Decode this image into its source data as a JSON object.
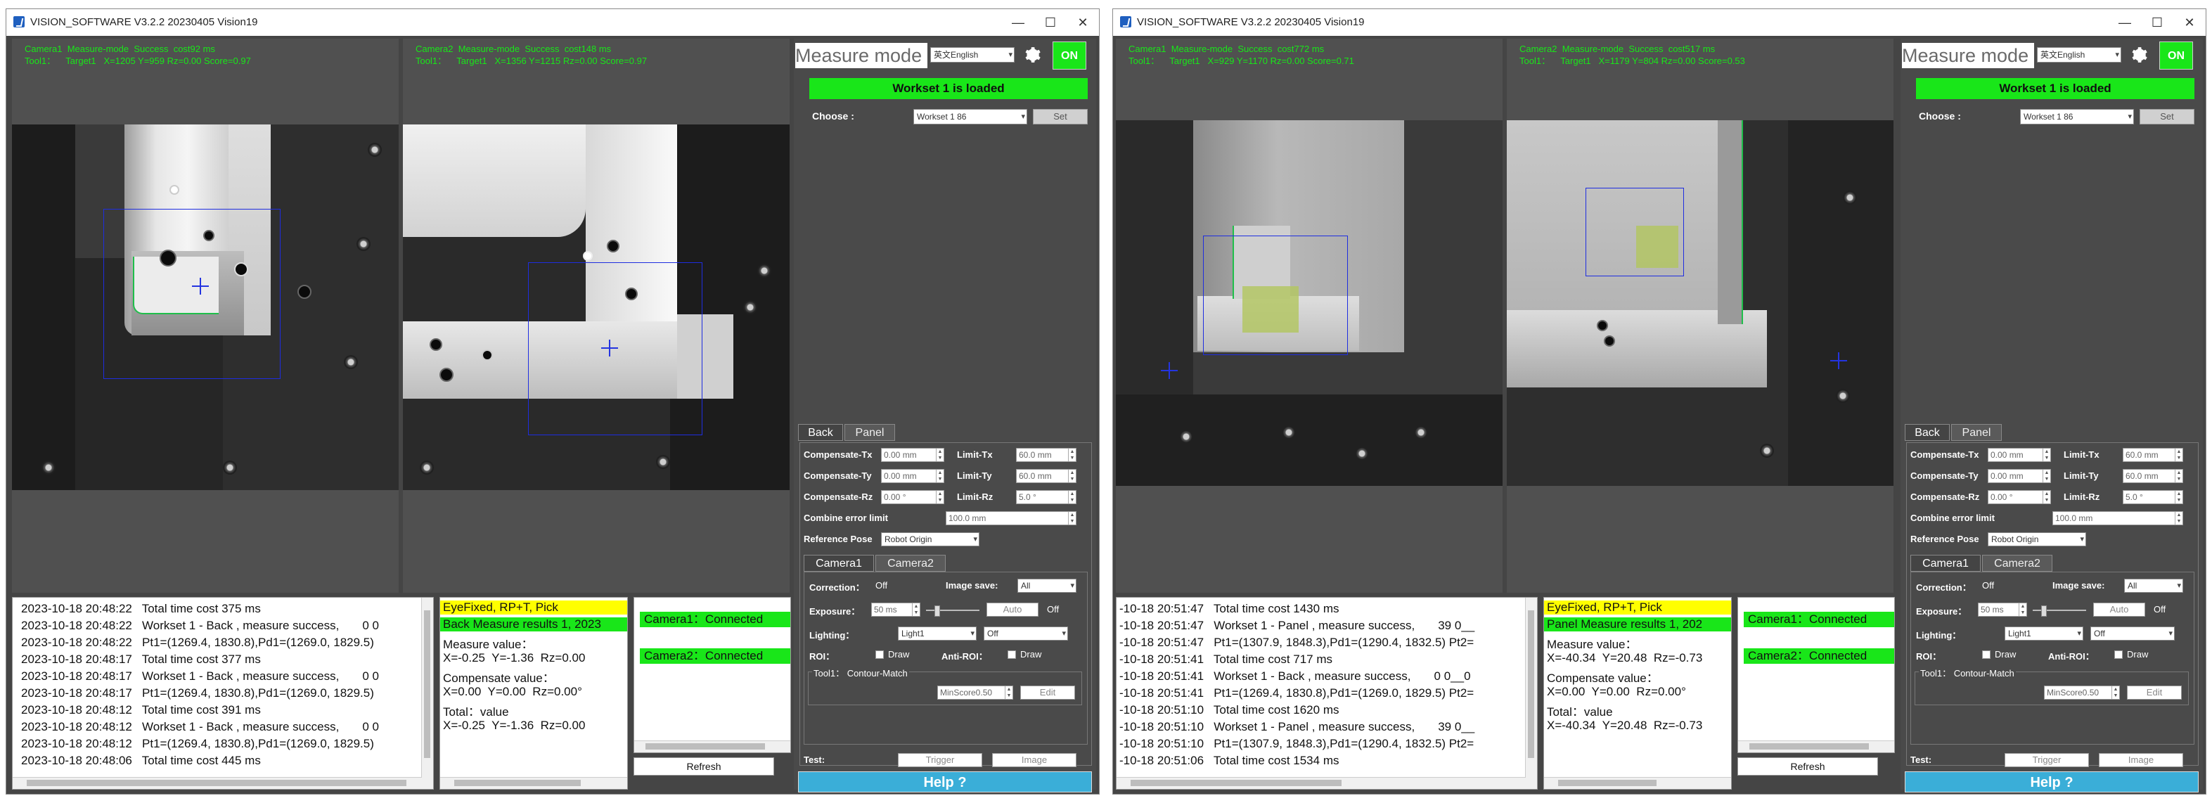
{
  "windows": [
    {
      "title": "VISION_SOFTWARE V3.2.2 20230405  Vision19",
      "cameras": [
        {
          "line1": "Camera1  Measure-mode  Success  cost92 ms",
          "line2": "Tool1：    Target1   X=1205 Y=959 Rz=0.00 Score=0.97"
        },
        {
          "line1": "Camera2  Measure-mode  Success  cost148 ms",
          "line2": "Tool1：    Target1   X=1356 Y=1215 Rz=0.00 Score=0.97"
        }
      ],
      "panel": {
        "title": "Measure mode",
        "language": "英文English",
        "on_label": "ON",
        "banner": "Workset 1 is loaded",
        "choose_label": "Choose :",
        "workset": "Workset 1 86",
        "set_label": "Set",
        "tab_back": "Back",
        "tab_panel": "Panel",
        "comp_tx_label": "Compensate-Tx",
        "comp_tx": "0.00 mm",
        "limit_tx_label": "Limit-Tx",
        "limit_tx": "60.0 mm",
        "comp_ty_label": "Compensate-Ty",
        "comp_ty": "0.00 mm",
        "limit_ty_label": "Limit-Ty",
        "limit_ty": "60.0 mm",
        "comp_rz_label": "Compensate-Rz",
        "comp_rz": "0.00 °",
        "limit_rz_label": "Limit-Rz",
        "limit_rz": "5.0 °",
        "combine_label": "Combine error limit",
        "combine": "100.0 mm",
        "refpose_label": "Reference Pose",
        "refpose": "Robot Origin",
        "tab_cam1": "Camera1",
        "tab_cam2": "Camera2",
        "correction_label": "Correction：",
        "correction": "Off",
        "imgsave_label": "Image save:",
        "imgsave": "All",
        "exposure_label": "Exposure：",
        "exposure": "50 ms",
        "auto_label": "Auto",
        "exposure_state": "Off",
        "lighting_label": "Lighting：",
        "lighting": "Light1",
        "lighting_state": "Off",
        "roi_label": "ROI：",
        "draw_label": "Draw",
        "anti_roi_label": "Anti-ROI：",
        "draw2_label": "Draw",
        "tool_label": "Tool1：  Contour-Match",
        "minscore": "MinScore0.50",
        "edit_label": "Edit",
        "test_label": "Test:",
        "trigger_label": "Trigger",
        "image_label": "Image",
        "help_label": "Help ?"
      },
      "log": [
        "2023-10-18 20:48:22   Total time cost 375 ms",
        "2023-10-18 20:48:22   Workset 1 - Back , measure success,       0 0",
        "2023-10-18 20:48:22   Pt1=(1269.4, 1830.8),Pd1=(1269.0, 1829.5)",
        "2023-10-18 20:48:17   Total time cost 377 ms",
        "2023-10-18 20:48:17   Workset 1 - Back , measure success,       0 0",
        "2023-10-18 20:48:17   Pt1=(1269.4, 1830.8),Pd1=(1269.0, 1829.5)",
        "2023-10-18 20:48:12   Total time cost 391 ms",
        "2023-10-18 20:48:12   Workset 1 - Back , measure success,       0 0",
        "2023-10-18 20:48:12   Pt1=(1269.4, 1830.8),Pd1=(1269.0, 1829.5)",
        "2023-10-18 20:48:06   Total time cost 445 ms"
      ],
      "results": [
        "EyeFixed, RP+T, Pick",
        "Back Measure results 1, 2023",
        "Measure value：",
        "X=-0.25  Y=-1.36  Rz=0.00",
        "Compensate value：",
        "X=0.00  Y=0.00  Rz=0.00°",
        "Total：value",
        "X=-0.25  Y=-1.36  Rz=0.00"
      ],
      "connections": [
        "Camera1：Connected",
        "Camera2：Connected"
      ],
      "refresh_label": "Refresh"
    },
    {
      "title": "VISION_SOFTWARE V3.2.2 20230405  Vision19",
      "cameras": [
        {
          "line1": "Camera1  Measure-mode  Success  cost772 ms",
          "line2": "Tool1：    Target1   X=929 Y=1170 Rz=0.00 Score=0.71"
        },
        {
          "line1": "Camera2  Measure-mode  Success  cost517 ms",
          "line2": "Tool1：    Target1   X=1179 Y=804 Rz=0.00 Score=0.53"
        }
      ],
      "panel": {
        "title": "Measure mode",
        "language": "英文English",
        "on_label": "ON",
        "banner": "Workset 1 is loaded",
        "choose_label": "Choose :",
        "workset": "Workset 1 86",
        "set_label": "Set",
        "tab_back": "Back",
        "tab_panel": "Panel",
        "comp_tx_label": "Compensate-Tx",
        "comp_tx": "0.00 mm",
        "limit_tx_label": "Limit-Tx",
        "limit_tx": "60.0 mm",
        "comp_ty_label": "Compensate-Ty",
        "comp_ty": "0.00 mm",
        "limit_ty_label": "Limit-Ty",
        "limit_ty": "60.0 mm",
        "comp_rz_label": "Compensate-Rz",
        "comp_rz": "0.00 °",
        "limit_rz_label": "Limit-Rz",
        "limit_rz": "5.0 °",
        "combine_label": "Combine error limit",
        "combine": "100.0 mm",
        "refpose_label": "Reference Pose",
        "refpose": "Robot Origin",
        "tab_cam1": "Camera1",
        "tab_cam2": "Camera2",
        "correction_label": "Correction：",
        "correction": "Off",
        "imgsave_label": "Image save:",
        "imgsave": "All",
        "exposure_label": "Exposure：",
        "exposure": "50 ms",
        "auto_label": "Auto",
        "exposure_state": "Off",
        "lighting_label": "Lighting：",
        "lighting": "Light1",
        "lighting_state": "Off",
        "roi_label": "ROI：",
        "draw_label": "Draw",
        "anti_roi_label": "Anti-ROI：",
        "draw2_label": "Draw",
        "tool_label": "Tool1：  Contour-Match",
        "minscore": "MinScore0.50",
        "edit_label": "Edit",
        "test_label": "Test:",
        "trigger_label": "Trigger",
        "image_label": "Image",
        "help_label": "Help ?"
      },
      "log": [
        "-10-18 20:51:47   Total time cost 1430 ms",
        "-10-18 20:51:47   Workset 1 - Panel , measure success,       39 0__",
        "-10-18 20:51:47   Pt1=(1307.9, 1848.3),Pd1=(1290.4, 1832.5) Pt2=",
        "-10-18 20:51:41   Total time cost 717 ms",
        "-10-18 20:51:41   Workset 1 - Back , measure success,       0 0__0",
        "-10-18 20:51:41   Pt1=(1269.4, 1830.8),Pd1=(1269.0, 1829.5) Pt2=",
        "-10-18 20:51:10   Total time cost 1620 ms",
        "-10-18 20:51:10   Workset 1 - Panel , measure success,       39 0__",
        "-10-18 20:51:10   Pt1=(1307.9, 1848.3),Pd1=(1290.4, 1832.5) Pt2=",
        "-10-18 20:51:06   Total time cost 1534 ms"
      ],
      "results": [
        "EyeFixed, RP+T, Pick",
        "Panel Measure results 1, 202",
        "Measure value：",
        "X=-40.34  Y=20.48  Rz=-0.73",
        "Compensate value：",
        "X=0.00  Y=0.00  Rz=0.00°",
        "Total：value",
        "X=-40.34  Y=20.48  Rz=-0.73"
      ],
      "connections": [
        "Camera1：Connected",
        "Camera2：Connected"
      ],
      "refresh_label": "Refresh"
    }
  ],
  "colors": {
    "accent_green": "#19e619",
    "help_blue": "#3aaed8",
    "highlight_yellow": "#ffff00",
    "roi_blue": "#1e2de0"
  },
  "icons": {
    "app": "app-logo-icon",
    "settings": "gear-icon",
    "minimize": "minimize-icon",
    "maximize": "maximize-icon",
    "close": "close-icon"
  }
}
